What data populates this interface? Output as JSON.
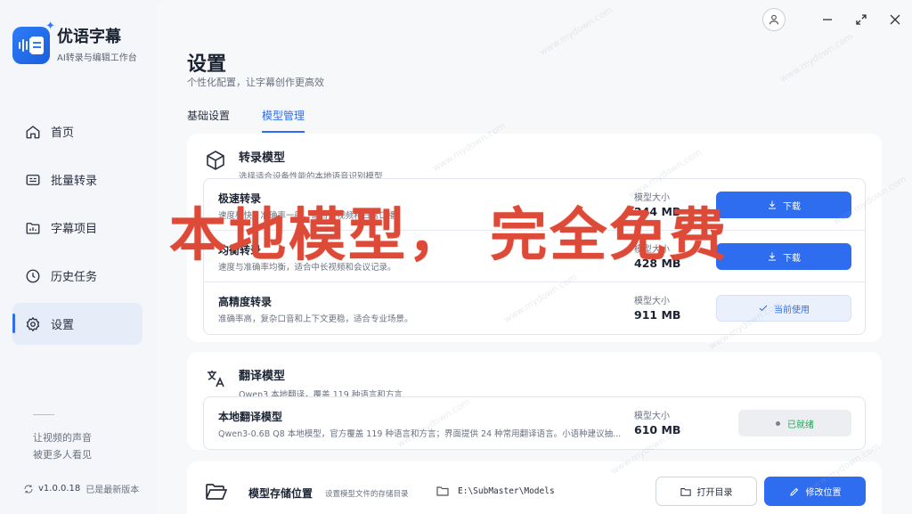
{
  "brand": {
    "title": "优语字幕",
    "subtitle": "AI转录与编辑工作台"
  },
  "nav": [
    {
      "label": "首页",
      "icon": "home-icon"
    },
    {
      "label": "批量转录",
      "icon": "batch-icon"
    },
    {
      "label": "字幕项目",
      "icon": "folder-icon"
    },
    {
      "label": "历史任务",
      "icon": "clock-icon"
    },
    {
      "label": "设置",
      "icon": "gear-icon",
      "active": true
    }
  ],
  "sidebar_footer": {
    "slogan_line1": "让视频的声音",
    "slogan_line2": "被更多人看见",
    "version": "v1.0.0.18",
    "status": "已是最新版本"
  },
  "page": {
    "title": "设置",
    "subtitle": "个性化配置，让字幕创作更高效"
  },
  "tabs": [
    {
      "label": "基础设置"
    },
    {
      "label": "模型管理",
      "active": true
    }
  ],
  "transcription": {
    "title": "转录模型",
    "desc": "选择适合设备性能的本地语音识别模型",
    "size_label": "模型大小",
    "models": [
      {
        "name": "极速转录",
        "desc": "速度极快，准确率一般，适合短视频和日常口播。",
        "size": "244 MB",
        "action": "下载"
      },
      {
        "name": "均衡转录",
        "desc": "速度与准确率均衡，适合中长视频和会议记录。",
        "size": "428 MB",
        "action": "下载"
      },
      {
        "name": "高精度转录",
        "desc": "准确率高，复杂口音和上下文更稳，适合专业场景。",
        "size": "911 MB",
        "action": "当前使用"
      }
    ]
  },
  "translation": {
    "title": "翻译模型",
    "desc": "Qwen3 本地翻译，覆盖 119 种语言和方言",
    "size_label": "模型大小",
    "model": {
      "name": "本地翻译模型",
      "desc": "Qwen3-0.6B Q8 本地模型，官方覆盖 119 种语言和方言；界面提供 24 种常用翻译语言。小语种建议抽...",
      "size": "610 MB",
      "status": "已就绪"
    }
  },
  "storage": {
    "title": "模型存储位置",
    "desc": "设置模型文件的存储目录",
    "path": "E:\\SubMaster\\Models",
    "open_label": "打开目录",
    "change_label": "修改位置"
  },
  "overlay_text": "本地模型，  完全免费",
  "watermark": "www.mydown.com",
  "colors": {
    "accent": "#2f6df0",
    "overlay": "#de4a38",
    "ready": "#22a55a"
  }
}
